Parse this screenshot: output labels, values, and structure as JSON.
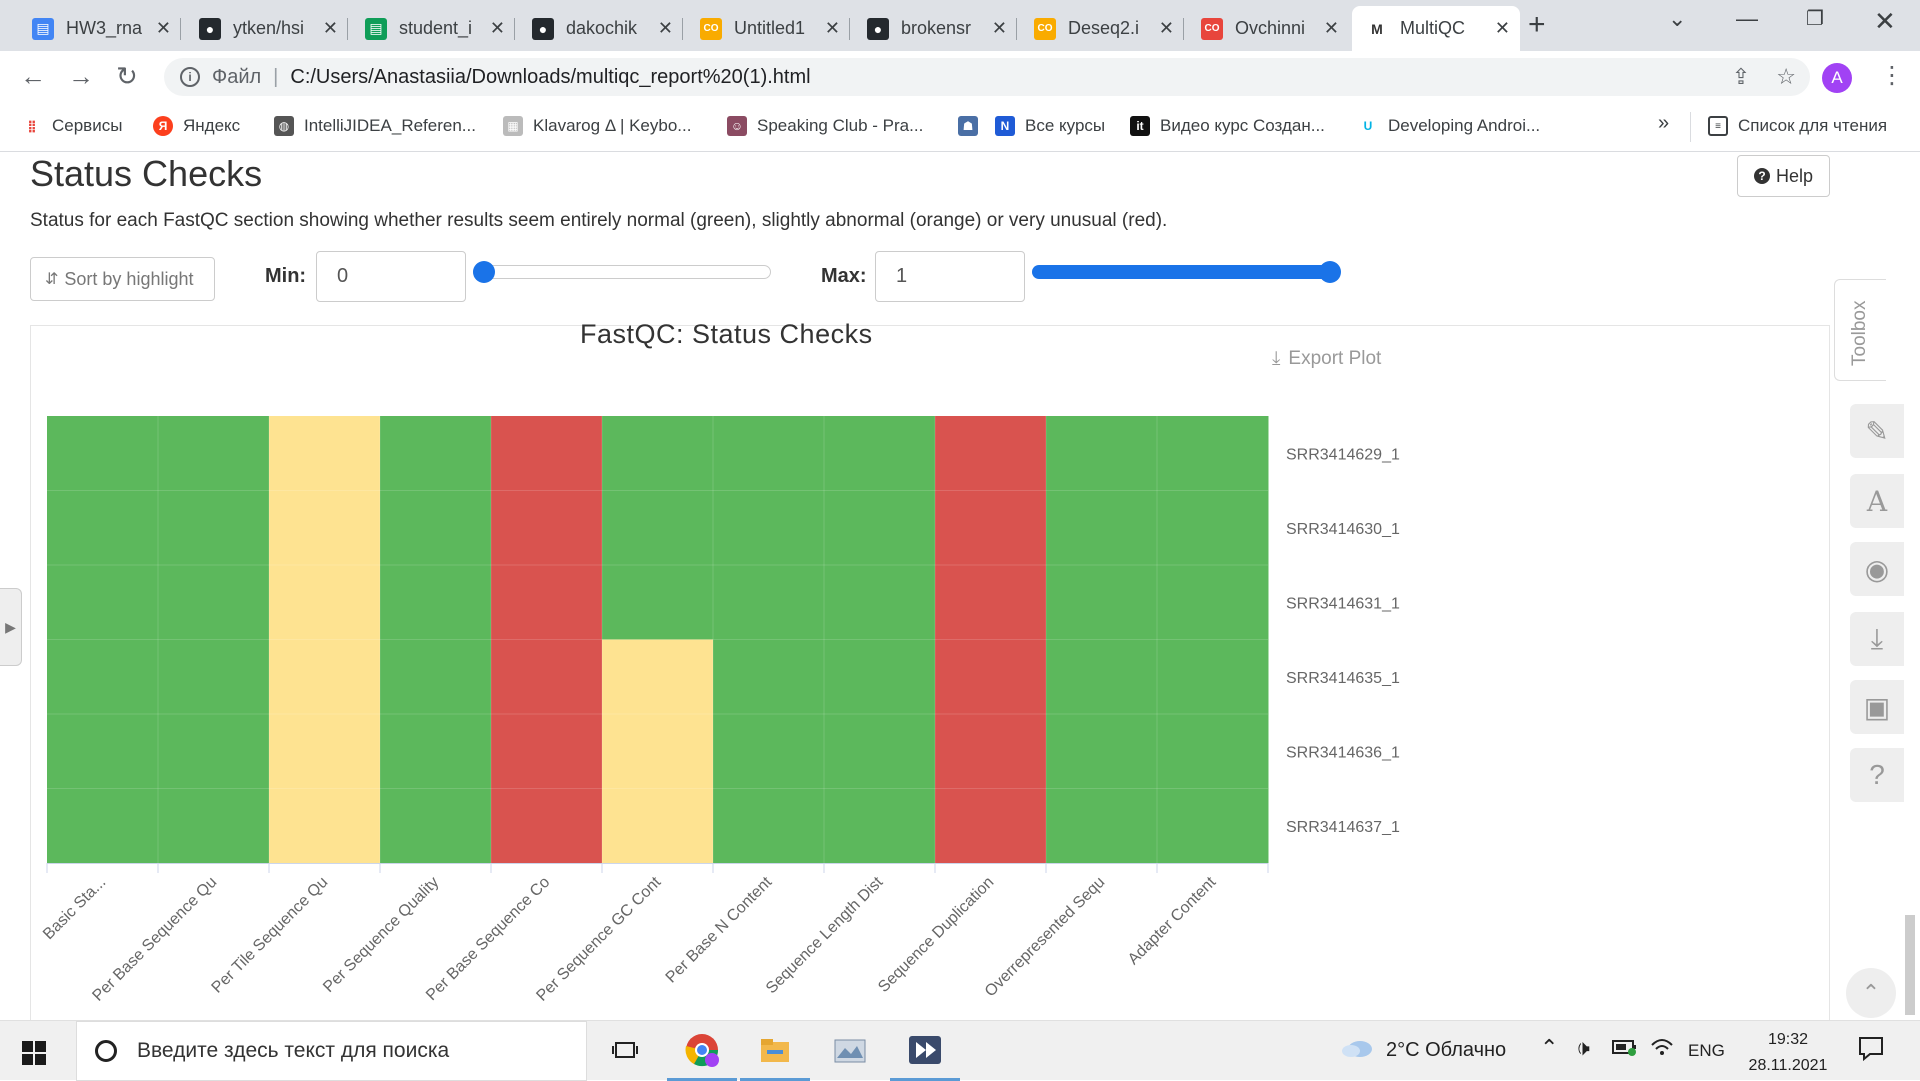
{
  "browser": {
    "tabs": [
      {
        "label": "HW3_rna",
        "icon": "google-docs-icon",
        "color": "#4285f4",
        "active": false
      },
      {
        "label": "ytken/hsi",
        "icon": "github-icon",
        "color": "#24292e",
        "active": false
      },
      {
        "label": "student_i",
        "icon": "google-sheets-icon",
        "color": "#0f9d58",
        "active": false
      },
      {
        "label": "dakochik",
        "icon": "github-icon",
        "color": "#24292e",
        "active": false
      },
      {
        "label": "Untitled1",
        "icon": "colab-icon",
        "color": "#f9ab00",
        "active": false
      },
      {
        "label": "brokensr",
        "icon": "github-icon",
        "color": "#24292e",
        "active": false
      },
      {
        "label": "Deseq2.i",
        "icon": "colab-icon",
        "color": "#f9ab00",
        "active": false
      },
      {
        "label": "Ovchinni",
        "icon": "colab-icon",
        "color": "#e8453c",
        "active": false
      },
      {
        "label": "MultiQC",
        "icon": "multiqc-icon",
        "color": "#333333",
        "active": true
      }
    ],
    "address": {
      "protocol": "Файл",
      "url": "C:/Users/Anastasiia/Downloads/multiqc_report%20(1).html"
    },
    "profile_initial": "A",
    "bookmarks": [
      {
        "label": "Сервисы",
        "icon": "apps-grid-icon"
      },
      {
        "label": "Яндекс",
        "icon": "yandex-icon"
      },
      {
        "label": "IntelliJIDEA_Referen...",
        "icon": "globe-icon"
      },
      {
        "label": "Klavarog Δ | Keybo...",
        "icon": "klavarog-icon"
      },
      {
        "label": "Speaking Club - Pra...",
        "icon": "speaking-club-icon"
      },
      {
        "label": "",
        "icon": "android-icon"
      },
      {
        "label": "Все курсы",
        "icon": "new-badge-icon"
      },
      {
        "label": "Видео курс Создан...",
        "icon": "it-icon"
      },
      {
        "label": "Developing Androi...",
        "icon": "udacity-icon"
      }
    ],
    "bookmarks_overflow": "»",
    "reading_list": "Список для чтения"
  },
  "page": {
    "title": "Status Checks",
    "help_label": "Help",
    "description": "Status for each FastQC section showing whether results seem entirely normal (green), slightly abnormal (orange) or very unusual (red).",
    "sort_label": "Sort by highlight",
    "min_label": "Min:",
    "min_value": "0",
    "max_label": "Max:",
    "max_value": "1",
    "min_slider_fraction": 0,
    "max_slider_fraction": 1,
    "export_label": "Export Plot",
    "toolbox_label": "Toolbox",
    "toolbox_icons": [
      "pin-icon",
      "font-icon",
      "eye-slash-icon",
      "download-icon",
      "save-icon",
      "question-icon"
    ]
  },
  "chart_data": {
    "type": "heatmap",
    "title": "FastQC: Status Checks",
    "x_categories": [
      "Basic Sta...",
      "Per Base Sequence Qu",
      "Per Tile Sequence Qu",
      "Per Sequence Quality",
      "Per Base Sequence Co",
      "Per Sequence GC Cont",
      "Per Base N Content",
      "Sequence Length Dist",
      "Sequence Duplication",
      "Overrepresented Sequ",
      "Adapter Content"
    ],
    "y_categories": [
      "SRR3414629_1",
      "SRR3414630_1",
      "SRR3414631_1",
      "SRR3414635_1",
      "SRR3414636_1",
      "SRR3414637_1"
    ],
    "status_colors": {
      "pass": "#5cb85c",
      "warn": "#fee391",
      "fail": "#d9534f"
    },
    "values": [
      [
        "pass",
        "pass",
        "warn",
        "pass",
        "fail",
        "pass",
        "pass",
        "pass",
        "fail",
        "pass",
        "pass"
      ],
      [
        "pass",
        "pass",
        "warn",
        "pass",
        "fail",
        "pass",
        "pass",
        "pass",
        "fail",
        "pass",
        "pass"
      ],
      [
        "pass",
        "pass",
        "warn",
        "pass",
        "fail",
        "pass",
        "pass",
        "pass",
        "fail",
        "pass",
        "pass"
      ],
      [
        "pass",
        "pass",
        "warn",
        "pass",
        "fail",
        "warn",
        "pass",
        "pass",
        "fail",
        "pass",
        "pass"
      ],
      [
        "pass",
        "pass",
        "warn",
        "pass",
        "fail",
        "warn",
        "pass",
        "pass",
        "fail",
        "pass",
        "pass"
      ],
      [
        "pass",
        "pass",
        "warn",
        "pass",
        "fail",
        "warn",
        "pass",
        "pass",
        "fail",
        "pass",
        "pass"
      ]
    ]
  },
  "taskbar": {
    "search_placeholder": "Введите здесь текст для поиска",
    "apps": [
      "task-view-icon",
      "chrome-icon",
      "file-explorer-icon",
      "photo-app-icon",
      "media-player-icon"
    ],
    "weather": "2°C  Облачно",
    "language": "ENG",
    "time": "19:32",
    "date": "28.11.2021"
  }
}
